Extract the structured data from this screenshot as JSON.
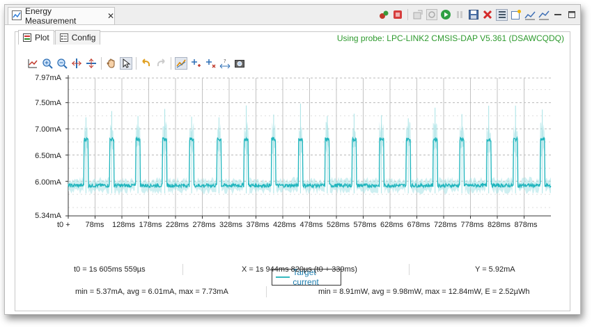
{
  "window": {
    "title": "Energy Measurement"
  },
  "tabs": {
    "plot": "Plot",
    "config": "Config"
  },
  "probe_status": "Using probe: LPC-LINK2 CMSIS-DAP V5.361 (DSAWCQDQ)",
  "colors": {
    "trace": "#1fb5bd",
    "trace_light": "#a6e2e5",
    "probe_text": "#2e9a2e",
    "grid": "#b8b8b8"
  },
  "toolbar_icons": [
    "probe-icon",
    "stop-icon",
    "export-icon",
    "sync-icon",
    "run-icon",
    "pause-icon",
    "save-icon",
    "delete-icon",
    "list-icon",
    "new-window-icon",
    "chart-icon",
    "chart-alt-icon",
    "minimize-icon",
    "maximize-icon"
  ],
  "plot_tool_icons": [
    "autoscale-icon",
    "zoom-in-icon",
    "zoom-out-icon",
    "zoom-x-icon",
    "zoom-y-icon",
    "pan-icon",
    "select-icon",
    "undo-icon",
    "redo-icon",
    "trace-icon",
    "add-marker-icon",
    "remove-marker-icon",
    "measure-icon",
    "snapshot-icon"
  ],
  "chart_data": {
    "type": "line",
    "y_ticks": [
      "7.97mA",
      "7.50mA",
      "7.00mA",
      "6.50mA",
      "6.00mA",
      "5.34mA"
    ],
    "x_ticks": [
      "t0 +",
      "78ms",
      "128ms",
      "178ms",
      "228ms",
      "278ms",
      "328ms",
      "378ms",
      "428ms",
      "478ms",
      "528ms",
      "578ms",
      "628ms",
      "678ms",
      "728ms",
      "778ms",
      "828ms",
      "878ms"
    ],
    "ylim": [
      5.34,
      7.97
    ],
    "xlim": [
      28,
      928
    ],
    "baseline_mA": 5.92,
    "peak_mA": 6.8,
    "pulse_starts_ms": [
      57,
      105,
      154,
      204,
      254,
      305,
      356,
      407,
      457,
      507,
      557,
      608,
      658,
      708,
      758,
      808,
      858,
      908
    ],
    "pulse_width_ms": 8,
    "series": [
      {
        "name": "Target current"
      }
    ],
    "grid": true,
    "legend_position": "bottom-center"
  },
  "stats": {
    "t0": "t0 = 1s 605ms 559µs",
    "x": "X = 1s 944ms 820µs (t0 + 339ms)",
    "y": "Y = 5.92mA",
    "current": "min = 5.37mA, avg = 6.01mA, max = 7.73mA",
    "power": "min = 8.91mW, avg = 9.98mW, max = 12.84mW, E = 2.52µWh"
  }
}
